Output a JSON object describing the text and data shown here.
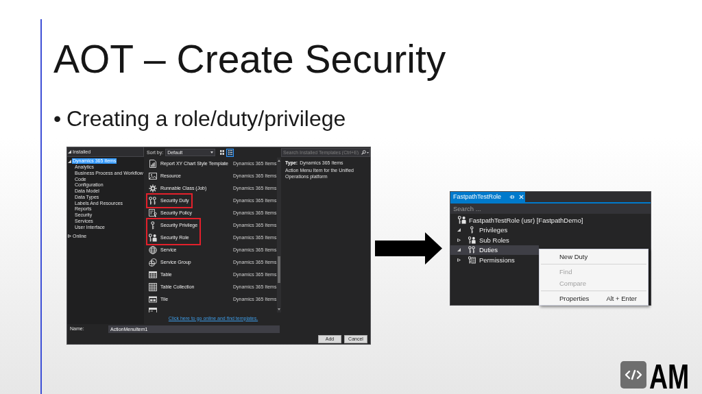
{
  "slide": {
    "title": "AOT – Create Security",
    "bullets": [
      {
        "marker": "•",
        "text": "Creating a role/duty/privilege"
      }
    ]
  },
  "new_item_dialog": {
    "installed_header": {
      "label": "Installed",
      "expanded": true
    },
    "tree": [
      {
        "label": "Dynamics 365 Items",
        "expanded": true,
        "selected": true,
        "children": [
          {
            "label": "Analytics",
            "selected": false
          },
          {
            "label": "Business Process and Workflow",
            "selected": false
          },
          {
            "label": "Code",
            "selected": false
          },
          {
            "label": "Configuration",
            "selected": false
          },
          {
            "label": "Data Model",
            "selected": false
          },
          {
            "label": "Data Types",
            "selected": false
          },
          {
            "label": "Labels And Resources",
            "selected": false
          },
          {
            "label": "Reports",
            "selected": false
          },
          {
            "label": "Security",
            "selected": false
          },
          {
            "label": "Services",
            "selected": false
          },
          {
            "label": "User Interface",
            "selected": false
          }
        ]
      },
      {
        "label": "Online",
        "expanded": false,
        "selected": false
      }
    ],
    "sort_by": {
      "label": "Sort by:",
      "value": "Default"
    },
    "view_buttons": [
      {
        "kind": "grid",
        "selected": false
      },
      {
        "kind": "list",
        "selected": true
      }
    ],
    "search": {
      "placeholder": "Search Installed Templates (Ctrl+E)"
    },
    "templates": [
      {
        "kind": "chart",
        "name": "Report XY Chart Style Template",
        "type": "Dynamics 365 Items",
        "boxed": false,
        "cut_off": false
      },
      {
        "kind": "resource",
        "name": "Resource",
        "type": "Dynamics 365 Items",
        "boxed": false,
        "cut_off": false
      },
      {
        "kind": "class",
        "name": "Runnable Class (Job)",
        "type": "Dynamics 365 Items",
        "boxed": false,
        "cut_off": false
      },
      {
        "kind": "duty",
        "name": "Security Duty",
        "type": "Dynamics 365 Items",
        "boxed": true,
        "cut_off": false
      },
      {
        "kind": "policy",
        "name": "Security Policy",
        "type": "Dynamics 365 Items",
        "boxed": false,
        "cut_off": false
      },
      {
        "kind": "privilege",
        "name": "Security Privilege",
        "type": "Dynamics 365 Items",
        "boxed": true,
        "cut_off": false
      },
      {
        "kind": "role",
        "name": "Security Role",
        "type": "Dynamics 365 Items",
        "boxed": true,
        "cut_off": false
      },
      {
        "kind": "service",
        "name": "Service",
        "type": "Dynamics 365 Items",
        "boxed": false,
        "cut_off": false
      },
      {
        "kind": "service_group",
        "name": "Service Group",
        "type": "Dynamics 365 Items",
        "boxed": false,
        "cut_off": false
      },
      {
        "kind": "table",
        "name": "Table",
        "type": "Dynamics 365 Items",
        "boxed": false,
        "cut_off": false
      },
      {
        "kind": "table_collection",
        "name": "Table Collection",
        "type": "Dynamics 365 Items",
        "boxed": false,
        "cut_off": false
      },
      {
        "kind": "tile",
        "name": "Tile",
        "type": "Dynamics 365 Items",
        "boxed": false,
        "cut_off": false
      },
      {
        "kind": "form",
        "boxed": false,
        "cut_off": true
      }
    ],
    "details": {
      "type_label": "Type:",
      "type_value": "Dynamics 365 Items",
      "description": "Action Menu Item for the Unified Operations platform"
    },
    "online_link": "Click here to go online and find templates.",
    "name_field": {
      "label": "Name:",
      "value": "ActionMenuItem1"
    },
    "buttons": [
      "Add",
      "Cancel"
    ]
  },
  "role_designer": {
    "tab": {
      "title": "FastpathTestRole",
      "selected": true
    },
    "search": {
      "placeholder": "Search ..."
    },
    "tree": [
      {
        "kind": "role",
        "label": "FastpathTestRole (usr) [FastpathDemo]",
        "selected": false,
        "children": [
          {
            "kind": "privilege",
            "label": "Privileges",
            "expanded": true,
            "selected": false
          },
          {
            "kind": "role",
            "label": "Sub Roles",
            "expanded": false,
            "selected": false
          },
          {
            "kind": "duty",
            "label": "Duties",
            "expanded": true,
            "selected": true
          },
          {
            "kind": "permission",
            "label": "Permissions",
            "expanded": false,
            "selected": false
          }
        ]
      }
    ],
    "context_menu": [
      {
        "kind": "item",
        "label": "New Duty",
        "disabled": false
      },
      {
        "kind": "separator"
      },
      {
        "kind": "item",
        "label": "Find",
        "disabled": true
      },
      {
        "kind": "item",
        "label": "Compare",
        "disabled": true
      },
      {
        "kind": "separator"
      },
      {
        "kind": "item",
        "label": "Properties",
        "shortcut": "Alt + Enter",
        "disabled": false
      }
    ]
  },
  "logo": {
    "text": "AM"
  }
}
